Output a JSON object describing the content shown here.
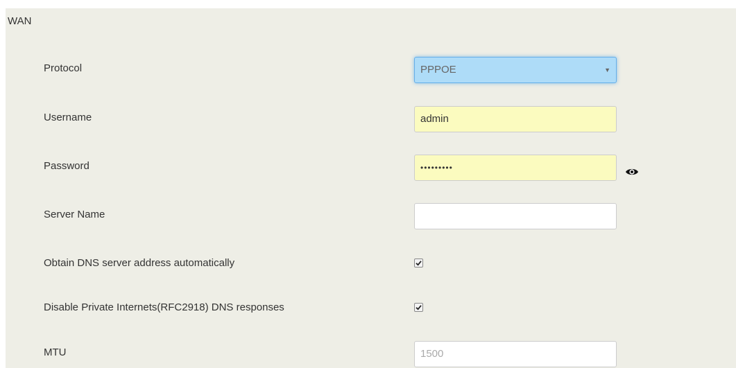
{
  "section": {
    "title": "WAN"
  },
  "fields": {
    "protocol": {
      "label": "Protocol",
      "value": "PPPOE",
      "options": [
        "PPPOE"
      ]
    },
    "username": {
      "label": "Username",
      "value": "admin"
    },
    "password": {
      "label": "Password",
      "value": "•••••••••"
    },
    "server_name": {
      "label": "Server Name",
      "value": ""
    },
    "obtain_dns": {
      "label": "Obtain DNS server address automatically",
      "checked": true
    },
    "disable_private_dns": {
      "label": "Disable Private Internets(RFC2918) DNS responses",
      "checked": true
    },
    "mtu": {
      "label": "MTU",
      "placeholder": "1500"
    }
  },
  "icons": {
    "password_toggle": "eye-icon",
    "dropdown": "chevron-down-icon",
    "checkmark": "checkmark-icon"
  },
  "colors": {
    "panel_bg": "#eeeee6",
    "autofill_bg": "#fbfbbf",
    "focus_bg": "#aedcf8",
    "focus_border": "#66afe9"
  }
}
